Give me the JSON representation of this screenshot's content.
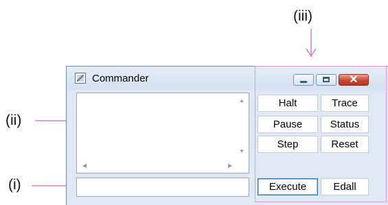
{
  "callouts": {
    "top": "(iii)",
    "middle": "(ii)",
    "bottom": "(i)"
  },
  "window": {
    "title": "Commander",
    "controls": {
      "minimize": "–",
      "maximize": "□",
      "close": "✕"
    }
  },
  "output_box": {
    "value": ""
  },
  "command_input": {
    "value": ""
  },
  "buttons": {
    "halt": "Halt",
    "trace": "Trace",
    "pause": "Pause",
    "status": "Status",
    "step": "Step",
    "reset": "Reset",
    "execute": "Execute",
    "edall": "Edall"
  },
  "colors": {
    "callout_arrow": "#d77fd4",
    "highlight_border": "#d99ad8"
  },
  "icons": [
    "app-icon",
    "minimize-icon",
    "maximize-icon",
    "close-icon",
    "arrow-icon"
  ]
}
